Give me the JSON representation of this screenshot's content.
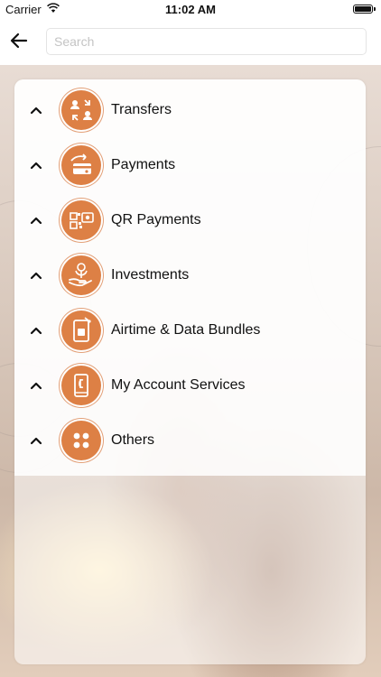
{
  "status_bar": {
    "carrier": "Carrier",
    "time": "11:02 AM"
  },
  "header": {
    "search_placeholder": "Search"
  },
  "menu": {
    "items": [
      {
        "label": "Transfers",
        "icon": "transfers-icon"
      },
      {
        "label": "Payments",
        "icon": "payments-icon"
      },
      {
        "label": "QR Payments",
        "icon": "qr-payments-icon"
      },
      {
        "label": "Investments",
        "icon": "investments-icon"
      },
      {
        "label": "Airtime & Data Bundles",
        "icon": "airtime-icon"
      },
      {
        "label": "My Account Services",
        "icon": "account-services-icon"
      },
      {
        "label": "Others",
        "icon": "others-icon"
      }
    ]
  },
  "colors": {
    "accent": "#dd8045",
    "text": "#111111"
  }
}
